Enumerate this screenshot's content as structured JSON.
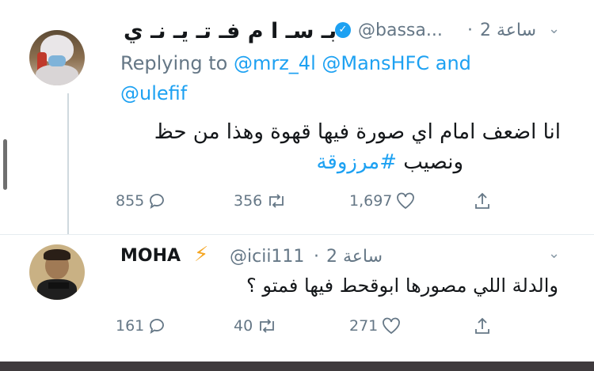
{
  "tweet1": {
    "display_name": "بـ سـ ا م فـ تـ يـ نـ ي",
    "handle": "@bassa...",
    "time": "2 ساعة",
    "separator": "·",
    "replying_prefix": "Replying to",
    "reply_to_1": "@mrz_4l",
    "reply_to_2": "@MansHFC",
    "reply_and": "and",
    "reply_to_3": "@ulefif",
    "text_line1": "انا اضعف امام اي صورة فيها قهوة وهذا من حظ",
    "text_line2_plain": "ونصيب",
    "text_line2_tag": "#مرزوقة",
    "replies": "855",
    "retweets": "356",
    "likes": "1,697"
  },
  "tweet2": {
    "display_name": "MOHA",
    "handle": "@icii111",
    "time": "2 ساعة",
    "separator": "·",
    "text": "والدلة اللي مصورها ابوقحط فيها فمتو ؟",
    "replies": "161",
    "retweets": "40",
    "likes": "271"
  },
  "icons": {
    "verified": "verified-check-icon",
    "bolt": "lightning-bolt-icon",
    "reply": "speech-bubble-icon",
    "retweet": "retweet-arrows-icon",
    "like": "heart-outline-icon",
    "share": "share-upload-icon",
    "more": "chevron-down-icon",
    "verified_glyph": "✓",
    "bolt_glyph": "⚡",
    "chevron_glyph": "⌄"
  },
  "colors": {
    "accent": "#1da1f2",
    "text": "#14171a",
    "muted": "#657786"
  }
}
